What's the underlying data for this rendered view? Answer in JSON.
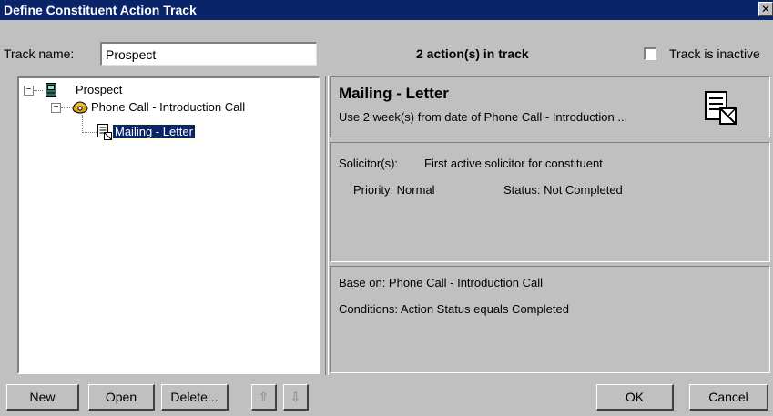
{
  "window": {
    "title": "Define Constituent Action Track"
  },
  "track": {
    "name_label": "Track name:",
    "name_value": "Prospect",
    "count_text": "2 action(s) in track",
    "inactive_label": "Track is inactive",
    "inactive_checked": false
  },
  "tree": {
    "root_label": "Prospect",
    "child_label": "Phone Call - Introduction Call",
    "grandchild_label": "Mailing - Letter"
  },
  "detail": {
    "action_title": "Mailing - Letter",
    "action_desc": "Use 2 week(s) from date of Phone Call - Introduction ...",
    "solicitor_label": "Solicitor(s):",
    "solicitor_value": "First active solicitor for constituent",
    "priority_text": "Priority: Normal",
    "status_text": "Status: Not Completed",
    "base_on_text": "Base on: Phone Call - Introduction Call",
    "conditions_text": "Conditions: Action Status equals Completed"
  },
  "buttons": {
    "new": "New",
    "open": "Open",
    "delete": "Delete...",
    "ok": "OK",
    "cancel": "Cancel"
  },
  "icons": {
    "close": "close-icon",
    "root": "notebook-icon",
    "child": "phone-icon",
    "grandchild": "letter-icon",
    "detail": "letter-icon",
    "up": "arrow-up-icon",
    "down": "arrow-down-icon"
  },
  "colors": {
    "title_bar": "#0a246a",
    "selection": "#0a246a",
    "face": "#c0c0c0"
  }
}
